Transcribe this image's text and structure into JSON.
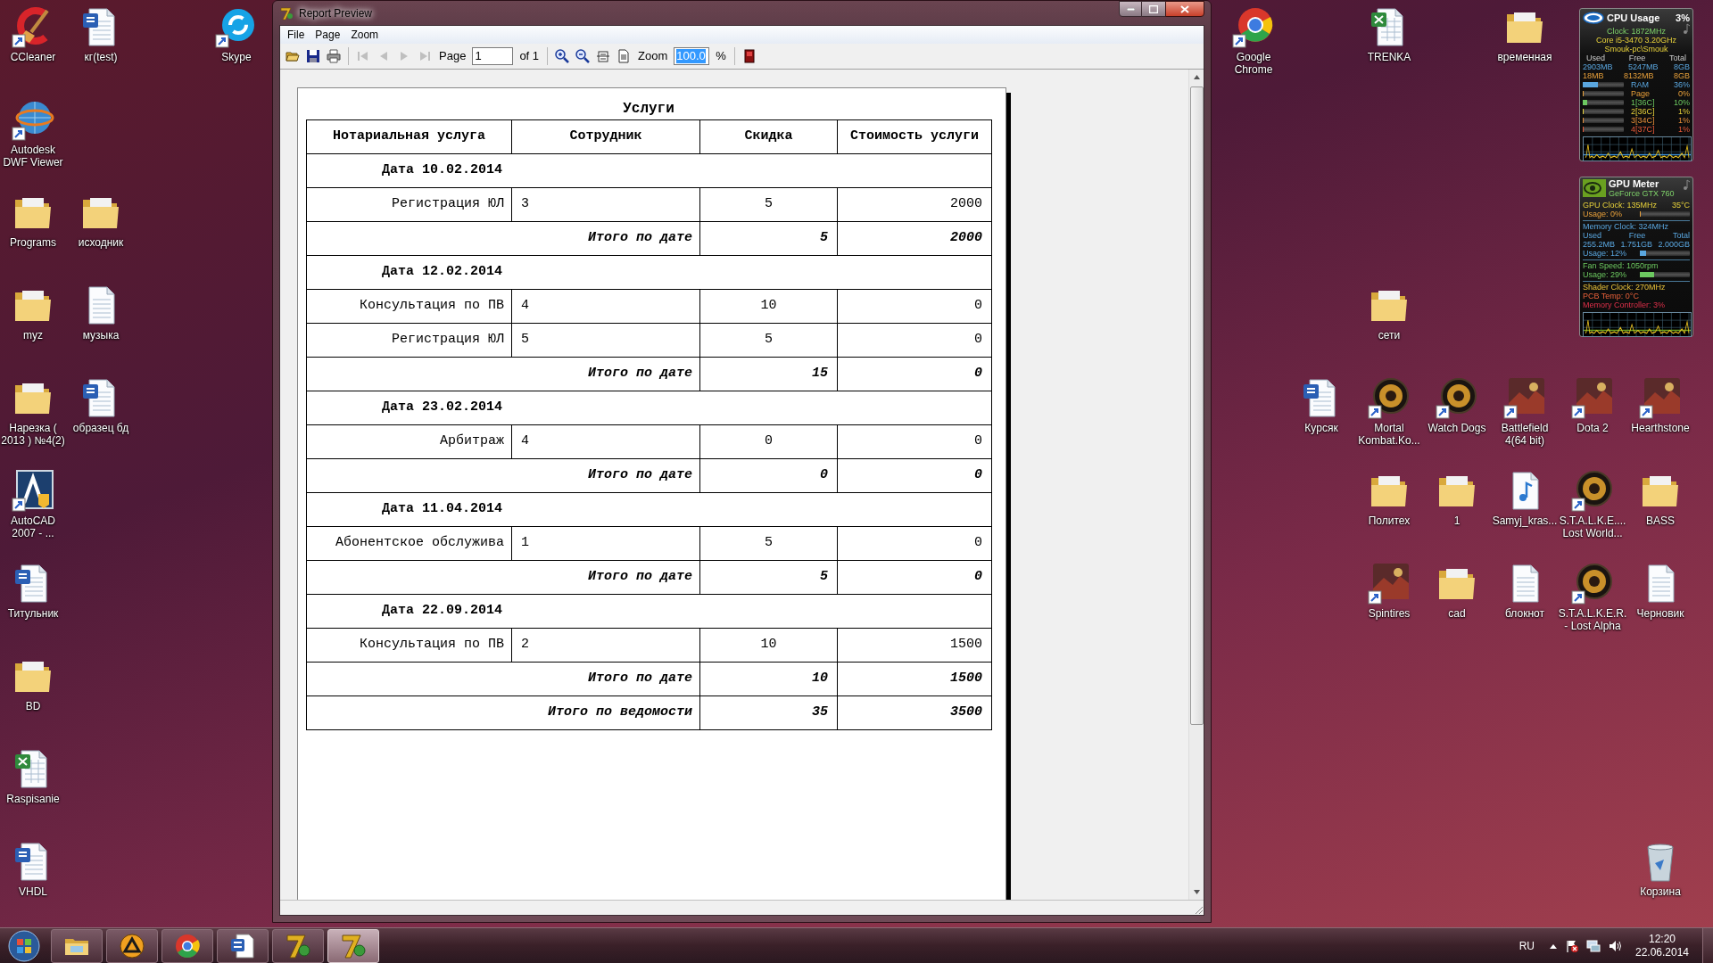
{
  "desktop_icons": [
    {
      "label": "CCleaner",
      "kind": "ccleaner",
      "shortcut": true
    },
    {
      "label": "кг(test)",
      "kind": "word",
      "shortcut": false
    },
    {
      "label": "Skype",
      "kind": "skype",
      "shortcut": true
    },
    {
      "label": "Google Chrome",
      "kind": "chrome",
      "shortcut": true
    },
    {
      "label": "TRENKA",
      "kind": "excel",
      "shortcut": false
    },
    {
      "label": "временная",
      "kind": "folder",
      "shortcut": false
    },
    {
      "label": "Autodesk DWF Viewer",
      "kind": "globe",
      "shortcut": true
    },
    {
      "label": "Programs",
      "kind": "folder",
      "shortcut": false
    },
    {
      "label": "исходник",
      "kind": "folder",
      "shortcut": false
    },
    {
      "label": "myz",
      "kind": "folder",
      "shortcut": false
    },
    {
      "label": "музыка",
      "kind": "text",
      "shortcut": false
    },
    {
      "label": "сети",
      "kind": "folder",
      "shortcut": false
    },
    {
      "label": "Нарезка ( 2013 ) №4(2)",
      "kind": "folder",
      "shortcut": false
    },
    {
      "label": "образец бд",
      "kind": "word",
      "shortcut": false
    },
    {
      "label": "Курсяк",
      "kind": "word",
      "shortcut": false
    },
    {
      "label": "Mortal Kombat.Ko...",
      "kind": "emblem",
      "shortcut": true
    },
    {
      "label": "Watch Dogs",
      "kind": "emblem",
      "shortcut": true
    },
    {
      "label": "Battlefield 4(64 bit)",
      "kind": "art",
      "shortcut": true
    },
    {
      "label": "Dota 2",
      "kind": "art",
      "shortcut": true
    },
    {
      "label": "Hearthstone",
      "kind": "art",
      "shortcut": true
    },
    {
      "label": "AutoCAD 2007 - ...",
      "kind": "autocad",
      "shortcut": true
    },
    {
      "label": "Политех",
      "kind": "folder",
      "shortcut": false
    },
    {
      "label": "1",
      "kind": "folder",
      "shortcut": false
    },
    {
      "label": "Samyj_kras...",
      "kind": "mp3",
      "shortcut": false
    },
    {
      "label": "S.T.A.L.K.E.... Lost World...",
      "kind": "emblem",
      "shortcut": true
    },
    {
      "label": "BASS",
      "kind": "folder",
      "shortcut": false
    },
    {
      "label": "Титульник",
      "kind": "word",
      "shortcut": false
    },
    {
      "label": "Spintires",
      "kind": "art",
      "shortcut": true
    },
    {
      "label": "cad",
      "kind": "folder",
      "shortcut": false
    },
    {
      "label": "блокнот",
      "kind": "text",
      "shortcut": false
    },
    {
      "label": "S.T.A.L.K.E.R. - Lost Alpha",
      "kind": "emblem",
      "shortcut": true
    },
    {
      "label": "Черновик",
      "kind": "text",
      "shortcut": false
    },
    {
      "label": "BD",
      "kind": "folder",
      "shortcut": false
    },
    {
      "label": "Raspisanie",
      "kind": "excel",
      "shortcut": false
    },
    {
      "label": "VHDL",
      "kind": "word",
      "shortcut": false
    },
    {
      "label": "Корзина",
      "kind": "recycle",
      "shortcut": false
    }
  ],
  "cpu_gadget": {
    "title": "CPU Usage",
    "value": "3%",
    "lines": [
      "Clock: 1872MHz",
      "Core i5-3470 3.20GHz",
      "Smouk-pc\\Smouk"
    ],
    "memory_columns": [
      "Used",
      "Free",
      "Total"
    ],
    "memory_rows": [
      [
        "2903MB",
        "5247MB",
        "8GB"
      ],
      [
        "18MB",
        "8132MB",
        "8GB"
      ]
    ],
    "meters": [
      {
        "label": "RAM",
        "value": "36%",
        "level": 0.36
      },
      {
        "label": "Page",
        "value": "0%",
        "level": 0
      },
      {
        "label": "1[36C]",
        "value": "10%",
        "level": 0.1
      },
      {
        "label": "2[36C]",
        "value": "1%",
        "level": 0.01
      },
      {
        "label": "3[34C]",
        "value": "1%",
        "level": 0.01
      },
      {
        "label": "4[37C]",
        "value": "1%",
        "level": 0.01
      }
    ]
  },
  "gpu_gadget": {
    "title": "GPU Meter",
    "subtitle": "GeForce GTX 760",
    "sections": [
      {
        "lines": [
          {
            "text": "GPU Clock: 135MHz",
            "right": "35°C"
          },
          {
            "text": "Usage: 0%",
            "level": 0
          }
        ]
      },
      {
        "lines": [
          {
            "text": "Memory Clock: 324MHz"
          },
          {
            "cells": [
              "Used",
              "Free",
              "Total"
            ]
          },
          {
            "cells": [
              "255.2MB",
              "1.751GB",
              "2.000GB"
            ]
          },
          {
            "text": "Usage: 12%",
            "level": 0.12
          }
        ]
      },
      {
        "lines": [
          {
            "text": "Fan Speed: 1050rpm"
          },
          {
            "text": "Usage: 29%",
            "level": 0.29
          }
        ]
      },
      {
        "lines": [
          {
            "text": "Shader Clock: 270MHz"
          },
          {
            "text": "PCB Temp: 0°C"
          },
          {
            "text": "Memory Controller: 3%"
          }
        ]
      }
    ]
  },
  "window": {
    "title": "Report Preview"
  },
  "menu": [
    "File",
    "Page",
    "Zoom"
  ],
  "toolbar": [
    {
      "kind": "open",
      "disabled": false
    },
    {
      "kind": "save",
      "disabled": false
    },
    {
      "kind": "print",
      "disabled": false
    },
    {
      "kind": "separator"
    },
    {
      "kind": "first",
      "disabled": true
    },
    {
      "kind": "prev",
      "disabled": true
    },
    {
      "kind": "next",
      "disabled": true
    },
    {
      "kind": "last",
      "disabled": true
    },
    {
      "kind": "label",
      "text": "Page"
    },
    {
      "kind": "input",
      "value": "1",
      "selected": false
    },
    {
      "kind": "label",
      "text": "of 1"
    },
    {
      "kind": "separator"
    },
    {
      "kind": "zoom-in",
      "disabled": false
    },
    {
      "kind": "zoom-out",
      "disabled": false
    },
    {
      "kind": "page-width",
      "disabled": false
    },
    {
      "kind": "whole-page",
      "disabled": false
    },
    {
      "kind": "label",
      "text": "Zoom"
    },
    {
      "kind": "input",
      "value": "100.0",
      "selected": true
    },
    {
      "kind": "label",
      "text": "%"
    },
    {
      "kind": "separator"
    },
    {
      "kind": "exit",
      "disabled": false
    }
  ],
  "report": {
    "title": "Услуги",
    "columns": [
      "Нотариальная услуга",
      "Сотрудник",
      "Скидка",
      "Стоимость услуги"
    ],
    "rows": [
      {
        "kind": "date",
        "text": "Дата 10.02.2014"
      },
      {
        "kind": "item",
        "cells": [
          "Регистрация ЮЛ",
          "3",
          "5",
          "2000"
        ]
      },
      {
        "kind": "subtotal",
        "label": "Итого по дате",
        "cells": [
          "5",
          "2000"
        ]
      },
      {
        "kind": "date",
        "text": "Дата 12.02.2014"
      },
      {
        "kind": "item",
        "cells": [
          "Консультация по ПВ",
          "4",
          "10",
          "0"
        ]
      },
      {
        "kind": "item",
        "cells": [
          "Регистрация ЮЛ",
          "5",
          "5",
          "0"
        ]
      },
      {
        "kind": "subtotal",
        "label": "Итого по дате",
        "cells": [
          "15",
          "0"
        ]
      },
      {
        "kind": "date",
        "text": "Дата 23.02.2014"
      },
      {
        "kind": "item",
        "cells": [
          "Арбитраж",
          "4",
          "0",
          "0"
        ]
      },
      {
        "kind": "subtotal",
        "label": "Итого по дате",
        "cells": [
          "0",
          "0"
        ]
      },
      {
        "kind": "date",
        "text": "Дата 11.04.2014"
      },
      {
        "kind": "item",
        "cells": [
          "Абонентское обслужива",
          "1",
          "5",
          "0"
        ]
      },
      {
        "kind": "subtotal",
        "label": "Итого по дате",
        "cells": [
          "5",
          "0"
        ]
      },
      {
        "kind": "date",
        "text": "Дата 22.09.2014"
      },
      {
        "kind": "item",
        "cells": [
          "Консультация по ПВ",
          "2",
          "10",
          "1500"
        ]
      },
      {
        "kind": "subtotal",
        "label": "Итого по дате",
        "cells": [
          "10",
          "1500"
        ]
      },
      {
        "kind": "total",
        "label": "Итого по ведомости",
        "cells": [
          "35",
          "3500"
        ]
      }
    ]
  },
  "taskbar": [
    {
      "kind": "explorer",
      "selected": false
    },
    {
      "kind": "player",
      "selected": false
    },
    {
      "kind": "chrome",
      "selected": false
    },
    {
      "kind": "word",
      "selected": false
    },
    {
      "kind": "app",
      "selected": false
    },
    {
      "kind": "app",
      "selected": true
    }
  ],
  "tray": {
    "language": "RU",
    "time": "12:20",
    "date": "22.06.2014"
  }
}
